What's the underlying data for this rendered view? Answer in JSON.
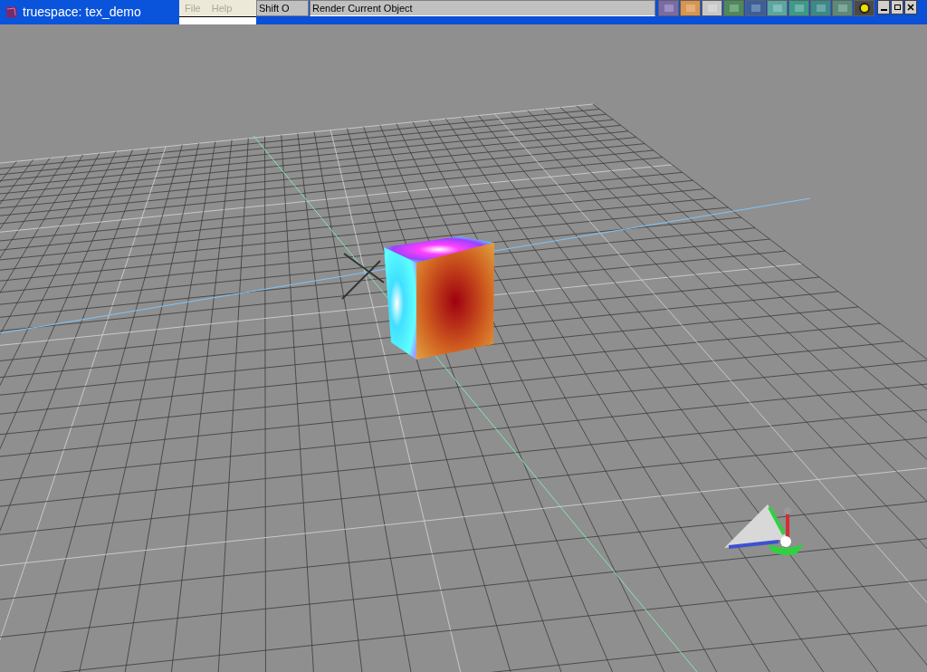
{
  "window": {
    "title": "truespace: tex_demo"
  },
  "menu": [
    {
      "label": "File",
      "disabled": true
    },
    {
      "label": "Help",
      "disabled": true
    }
  ],
  "shortcut": "Shift O",
  "status": "Render Current Object"
}
